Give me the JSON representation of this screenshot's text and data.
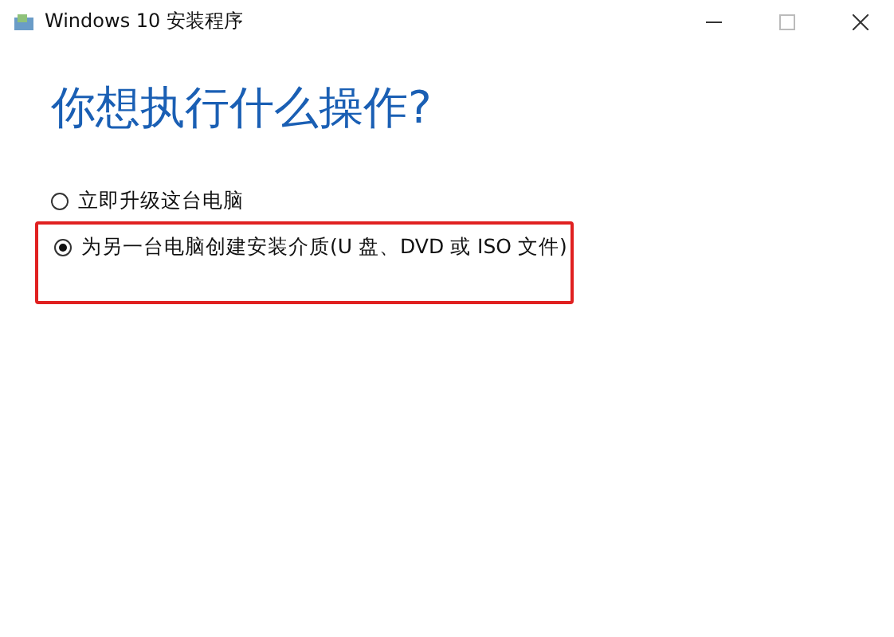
{
  "window": {
    "title": "Windows 10 安装程序"
  },
  "heading": "你想执行什么操作?",
  "options": [
    {
      "label": "立即升级这台电脑",
      "selected": false,
      "highlighted": false
    },
    {
      "label": "为另一台电脑创建安装介质(U 盘、DVD 或 ISO 文件)",
      "selected": true,
      "highlighted": true
    }
  ]
}
